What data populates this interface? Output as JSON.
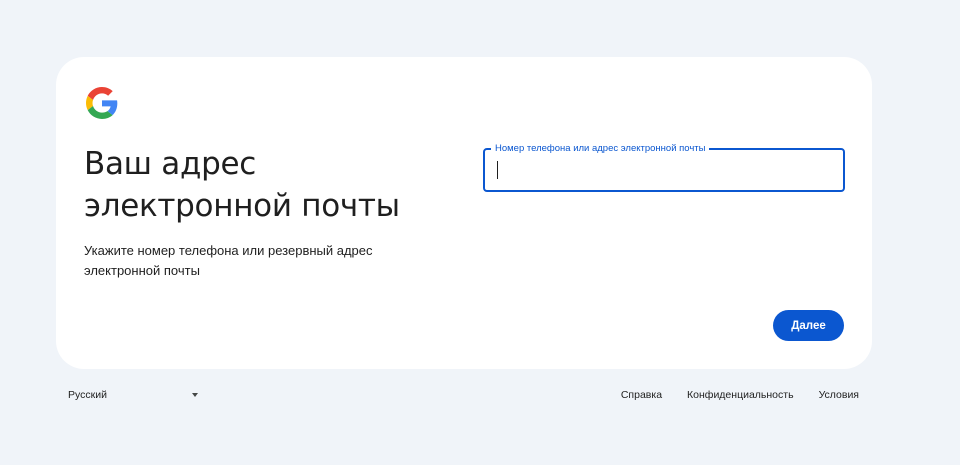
{
  "logo": {
    "icon": "google-g-logo-icon",
    "colors": [
      "#4285f4",
      "#ea4335",
      "#fbbc05",
      "#34a853"
    ]
  },
  "heading": {
    "line1": "Ваш адрес",
    "line2": "электронной почты"
  },
  "subtitle": {
    "line1": "Укажите номер телефона или резервный адрес",
    "line2": "электронной почты"
  },
  "email_field": {
    "label": "Номер телефона или адрес электронной почты",
    "value": ""
  },
  "next_button": {
    "label": "Далее"
  },
  "footer": {
    "language": "Русский",
    "links": [
      "Справка",
      "Конфиденциальность",
      "Условия"
    ]
  },
  "colors": {
    "background": "#f0f4f9",
    "card": "#ffffff",
    "accent": "#0b57d0"
  }
}
